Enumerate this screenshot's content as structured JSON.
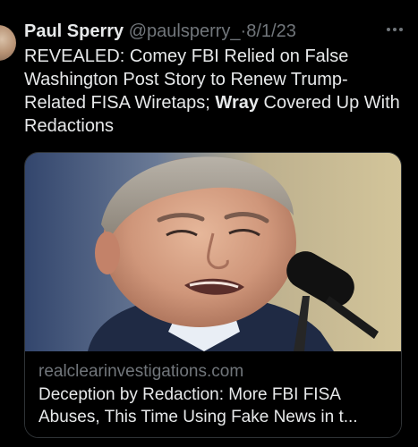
{
  "tweet": {
    "author_name": "Paul Sperry",
    "handle": "@paulsperry_",
    "separator": "·",
    "date": "8/1/23",
    "text_before": "REVEALED: Comey FBI Relied on False Washington Post Story to Renew Trump-Related FISA Wiretaps; ",
    "text_bold": "Wray",
    "text_after": " Covered Up With Redactions"
  },
  "link_card": {
    "domain": "realclearinvestigations.com",
    "title": "Deception by Redaction: More FBI FISA Abuses, This Time Using Fake News in t..."
  },
  "icons": {
    "more": "more-horizontal-icon",
    "avatar": "profile-photo"
  },
  "colors": {
    "background": "#000000",
    "primary_text": "#e7e9ea",
    "secondary_text": "#71767b",
    "card_border": "#2f3336"
  }
}
